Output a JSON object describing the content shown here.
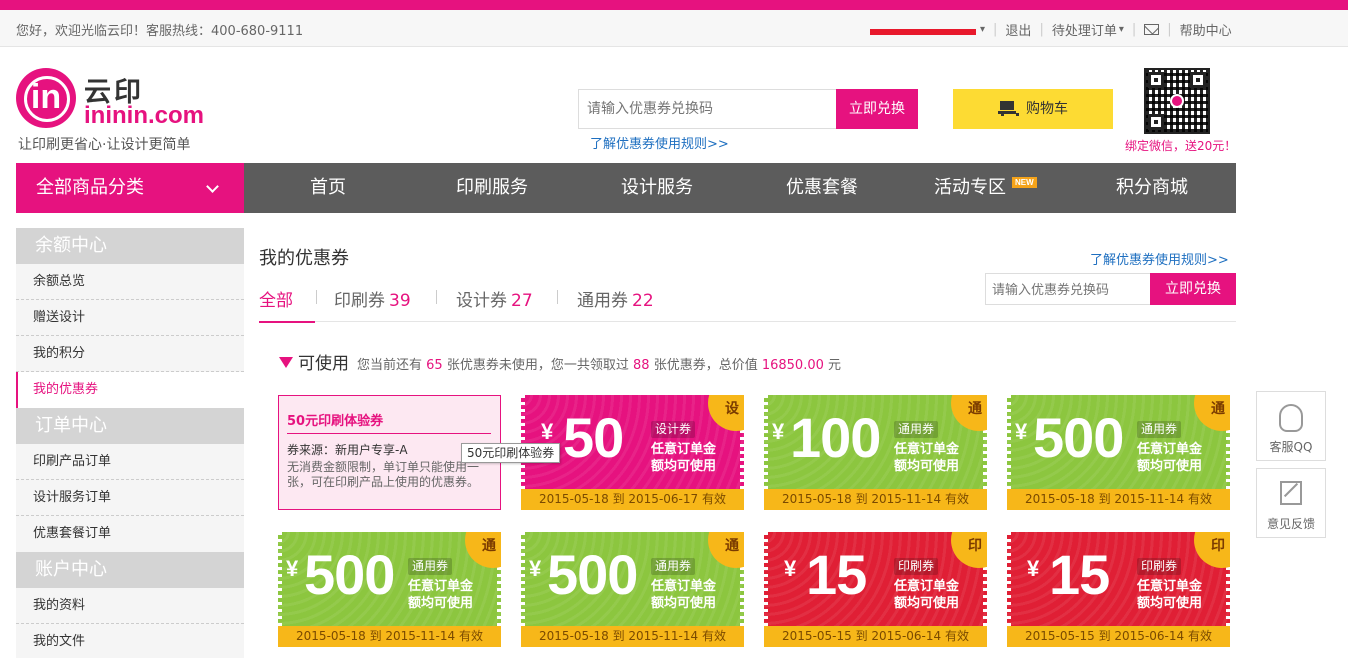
{
  "topbar": {
    "welcome": "您好，欢迎光临云印！客服热线：400-680-9111",
    "logout": "退出",
    "pending": "待处理订单",
    "help": "帮助中心"
  },
  "header": {
    "logo_cn": "云印",
    "logo_en": "ininin.com",
    "logo_letters": "in",
    "slogan": "让印刷更省心·让设计更简单",
    "search_placeholder": "请输入优惠券兑换码",
    "search_button": "立即兑换",
    "rule_link": "了解优惠券使用规则>>",
    "cart": "购物车",
    "qr_text": "绑定微信，送20元！"
  },
  "nav": {
    "all_categories": "全部商品分类",
    "items": [
      "首页",
      "印刷服务",
      "设计服务",
      "优惠套餐",
      "活动专区",
      "积分商城"
    ],
    "new_badge": "NEW"
  },
  "sidebar": {
    "groups": [
      {
        "title": "余额中心",
        "items": [
          "余额总览",
          "赠送设计",
          "我的积分",
          "我的优惠券"
        ]
      },
      {
        "title": "订单中心",
        "items": [
          "印刷产品订单",
          "设计服务订单",
          "优惠套餐订单"
        ]
      },
      {
        "title": "账户中心",
        "items": [
          "我的资料",
          "我的文件"
        ]
      }
    ],
    "active": "我的优惠券"
  },
  "main": {
    "title": "我的优惠券",
    "rule_link": "了解优惠券使用规则>>",
    "search_placeholder": "请输入优惠券兑换码",
    "search_button": "立即兑换",
    "tabs": [
      {
        "label": "全部",
        "count": ""
      },
      {
        "label": "印刷券",
        "count": "39"
      },
      {
        "label": "设计券",
        "count": "27"
      },
      {
        "label": "通用券",
        "count": "22"
      }
    ],
    "usable": {
      "label": "可使用",
      "p1": "您当前还有",
      "unused": "65",
      "p2": "张优惠券未使用，您一共领取过",
      "received": "88",
      "p3": "张优惠券，总价值",
      "total": "16850.00",
      "p4": "元"
    }
  },
  "experience_coupon": {
    "title": "50元印刷体验券",
    "source": "券来源：新用户专享-A",
    "desc": "无消费金额限制，单订单只能使用一张，可在印刷产品上使用的优惠券。",
    "tooltip": "50元印刷体验券"
  },
  "coupons": [
    {
      "color": "pink",
      "corner": "设",
      "yen": "¥",
      "amount": "50",
      "tag": "设计券",
      "cond1": "任意订单金",
      "cond2": "额均可使用",
      "date": "2015-05-18 到 2015-06-17 有效"
    },
    {
      "color": "green",
      "corner": "通",
      "yen": "¥",
      "amount": "100",
      "tag": "通用券",
      "cond1": "任意订单金",
      "cond2": "额均可使用",
      "date": "2015-05-18 到 2015-11-14 有效"
    },
    {
      "color": "green",
      "corner": "通",
      "yen": "¥",
      "amount": "500",
      "tag": "通用券",
      "cond1": "任意订单金",
      "cond2": "额均可使用",
      "date": "2015-05-18 到 2015-11-14 有效"
    },
    {
      "color": "green",
      "corner": "通",
      "yen": "¥",
      "amount": "500",
      "tag": "通用券",
      "cond1": "任意订单金",
      "cond2": "额均可使用",
      "date": "2015-05-18 到 2015-11-14 有效"
    },
    {
      "color": "green",
      "corner": "通",
      "yen": "¥",
      "amount": "500",
      "tag": "通用券",
      "cond1": "任意订单金",
      "cond2": "额均可使用",
      "date": "2015-05-18 到 2015-11-14 有效"
    },
    {
      "color": "red",
      "corner": "印",
      "yen": "¥",
      "amount": "15",
      "tag": "印刷券",
      "cond1": "任意订单金",
      "cond2": "额均可使用",
      "date": "2015-05-15 到 2015-06-14 有效"
    },
    {
      "color": "red",
      "corner": "印",
      "yen": "¥",
      "amount": "15",
      "tag": "印刷券",
      "cond1": "任意订单金",
      "cond2": "额均可使用",
      "date": "2015-05-15 到 2015-06-14 有效"
    }
  ],
  "float": {
    "qq": "客服QQ",
    "feedback": "意见反馈"
  },
  "colors": {
    "brand": "#e6127f",
    "green": "#8cc63f",
    "red": "#e01f35",
    "yellow": "#f7b719",
    "link": "#1e6fc0"
  },
  "icons": [
    "cart-icon",
    "mail-icon",
    "chevron-down-icon",
    "qq-icon",
    "feedback-icon",
    "qr-code"
  ]
}
